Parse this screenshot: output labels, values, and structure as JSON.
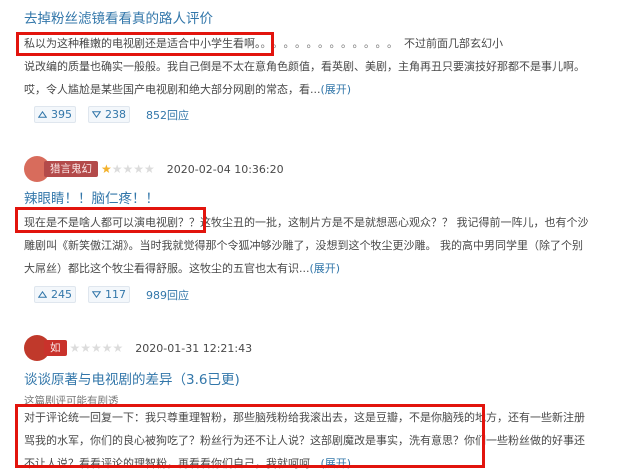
{
  "reviews": [
    {
      "title": "去掉粉丝滤镜看看真的路人评价",
      "lines": [
        "私以为这种稚嫩的电视剧还是适合中小学生看啊。",
        "说改编的质量也确实一般般。我自己倒是不太在意角色颜值，看英剧、美剧，主角再丑只要演技好那都不是事儿啊。",
        "哎，令人尴尬是某些国产电视剧和绝大部分网剧的常态，看..."
      ],
      "line1_dots": "。。。。。。。。。。。。",
      "line1_tail": "不过前面几部玄幻小",
      "expand": "(展开)",
      "up": "395",
      "down": "238",
      "replies": "852回应"
    },
    {
      "user": "猎言鬼幻",
      "date": "2020-02-04 10:36:20",
      "rating": 1,
      "title": "辣眼睛！！脑仁疼！！",
      "lines": [
        "现在是不是啥人都可以演电视剧？？这牧尘丑的一批，这制片方是不是就想恶心观众？？ 我记得前一阵儿，也有个沙",
        "雕剧叫《新笑傲江湖》。当时我就觉得那个令狐冲够沙雕了，没想到这个牧尘更沙雕。 我的高中男同学里（除了个别",
        "大屌丝）都比这个牧尘看得舒服。这牧尘的五官也太有识..."
      ],
      "expand": "(展开)",
      "up": "245",
      "down": "117",
      "replies": "989回应"
    },
    {
      "user": "如",
      "date": "2020-01-31 12:21:43",
      "rating": 0,
      "title": "谈谈原著与电视剧的差异（3.6已更)",
      "spoiler": "这篇剧评可能有剧透",
      "lines": [
        "对于评论统一回复一下：我只尊重理智粉，那些脑残粉给我滚出去，这是豆瓣，不是你脑残的地方，还有一些新注册",
        "骂我的水军，你们的良心被狗吃了？粉丝行为还不让人说？这部剧魔改是事实，洗有意思？你们一些粉丝做的好事还",
        "不让人说？看看评论的理智粉，再看看你们自己，我就呵呵..."
      ],
      "expand": "(展开)"
    }
  ],
  "colors": {
    "link": "#3377aa",
    "highlight": "#e2140d",
    "star_on": "#f3b12b",
    "star_off": "#dcdcdc"
  },
  "icons": {
    "up": "triangle-up-icon",
    "down": "triangle-down-icon"
  }
}
